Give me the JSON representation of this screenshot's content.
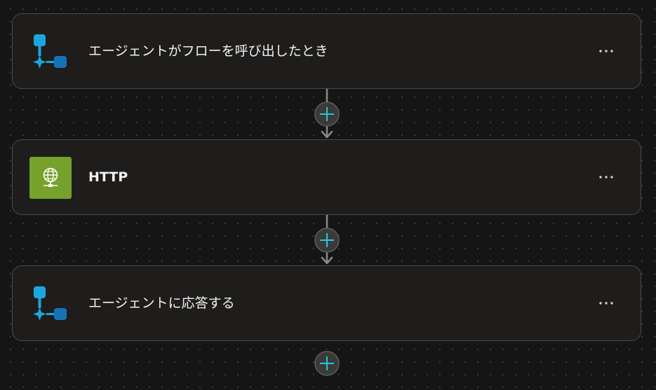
{
  "flow": {
    "steps": [
      {
        "title": "エージェントがフローを呼び出したとき",
        "icon": "agent-trigger-icon",
        "menu_icon": "more-options-icon"
      },
      {
        "title": "HTTP",
        "icon": "http-globe-icon",
        "menu_icon": "more-options-icon"
      },
      {
        "title": "エージェントに応答する",
        "icon": "agent-respond-icon",
        "menu_icon": "more-options-icon"
      }
    ],
    "add_step_icon": "plus-icon",
    "colors": {
      "canvas": "#151515",
      "card_bg": "#1e1d1c",
      "card_border": "#4a4a4a",
      "agent_icon": "#1aa7df",
      "http_icon_bg": "#76a12a",
      "plus_accent": "#2ec5d3",
      "connector": "#8a8a8a"
    }
  }
}
